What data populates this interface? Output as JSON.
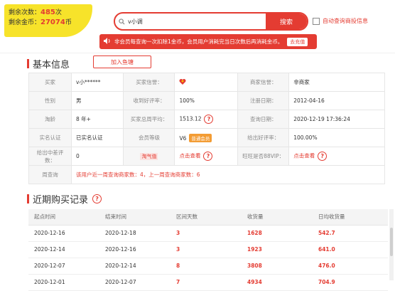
{
  "badge": {
    "remaining_times_label": "剩余次数：",
    "remaining_times": "485",
    "times_unit": "次",
    "remaining_coins_label": "剩余金币：",
    "remaining_coins": "27074",
    "coins_unit": "币"
  },
  "search": {
    "value": "v小调",
    "button": "搜索",
    "auto_query_label": "自动查询商投信息"
  },
  "notice": {
    "text": "非会员每查询一次扣除1金币，会员用户消耗完当日次数后再消耗金币。",
    "charge_button": "去充值"
  },
  "basic": {
    "title": "基本信息",
    "add_fish": "加入鱼塘",
    "rows": [
      [
        {
          "label": "买家",
          "value": "v小******"
        },
        {
          "label": "买家信誉：",
          "value": ""
        },
        {
          "label": "商家信誉：",
          "value": "非商家"
        }
      ],
      [
        {
          "label": "性别",
          "value": "男"
        },
        {
          "label": "收到好评率：",
          "value": "100%"
        },
        {
          "label": "注册日期：",
          "value": "2012-04-16"
        }
      ],
      [
        {
          "label": "淘龄",
          "value": "8 年+"
        },
        {
          "label": "买家总周平均：",
          "value": "1513.12"
        },
        {
          "label": "查询日期：",
          "value": "2020-12-19 17:36:24"
        }
      ],
      [
        {
          "label": "实名认证",
          "value": "已实名认证"
        },
        {
          "label": "会员等级",
          "value": "V6"
        },
        {
          "label": "给出好评率：",
          "value": "100.00%"
        }
      ],
      [
        {
          "label": "给出中差评数：",
          "value": "0"
        },
        {
          "label": "淘气值",
          "value": "点击查看"
        },
        {
          "label": "旺旺是否88VIP：",
          "value": "点击查看"
        }
      ]
    ],
    "vip_tag": "普通会员",
    "weekly": {
      "label": "周查询",
      "text_a": "该用户近一周查询商家数：",
      "count_a": "4",
      "text_b": "，上一周查询商家数：",
      "count_b": "6"
    }
  },
  "purchases": {
    "title": "近期购买记录",
    "columns": [
      "起点时间",
      "结束时间",
      "区间天数",
      "收货量",
      "日均收货量"
    ],
    "rows": [
      [
        "2020-12-16",
        "2020-12-18",
        "3",
        "1628",
        "542.7"
      ],
      [
        "2020-12-14",
        "2020-12-16",
        "3",
        "1923",
        "641.0"
      ],
      [
        "2020-12-07",
        "2020-12-14",
        "8",
        "3808",
        "476.0"
      ],
      [
        "2020-12-01",
        "2020-12-07",
        "7",
        "4934",
        "704.9"
      ]
    ]
  },
  "colors": {
    "accent": "#e43c32",
    "badge": "#f7e32a",
    "vip": "#f39c34"
  }
}
